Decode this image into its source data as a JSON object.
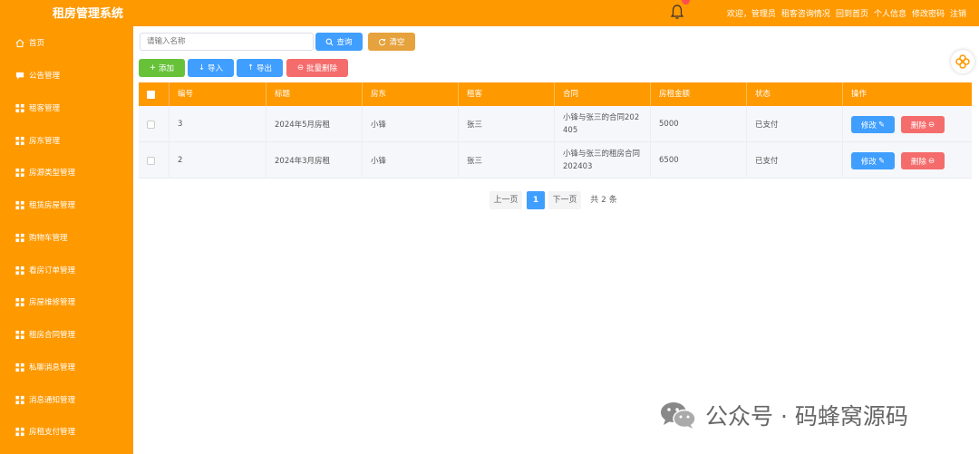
{
  "app": {
    "title": "租房管理系统"
  },
  "topbar": {
    "links": [
      "欢迎，管理员",
      "租客咨询情况",
      "回到首页",
      "个人信息",
      "修改密码",
      "注销"
    ]
  },
  "sidebar": {
    "items": [
      {
        "label": "首页",
        "icon": "home-icon"
      },
      {
        "label": "公告管理",
        "icon": "notice-icon"
      },
      {
        "label": "租客管理",
        "icon": "grid-icon"
      },
      {
        "label": "房东管理",
        "icon": "grid-icon"
      },
      {
        "label": "房源类型管理",
        "icon": "grid-icon"
      },
      {
        "label": "租赁房屋管理",
        "icon": "grid-icon"
      },
      {
        "label": "购物车管理",
        "icon": "grid-icon"
      },
      {
        "label": "看房订单管理",
        "icon": "grid-icon"
      },
      {
        "label": "房屋维修管理",
        "icon": "grid-icon"
      },
      {
        "label": "租房合同管理",
        "icon": "grid-icon"
      },
      {
        "label": "私聊消息管理",
        "icon": "grid-icon"
      },
      {
        "label": "消息通知管理",
        "icon": "grid-icon"
      },
      {
        "label": "房租支付管理",
        "icon": "grid-icon"
      }
    ]
  },
  "toolbar": {
    "search_placeholder": "请输入名称",
    "search_label": "查询",
    "clear_label": "清空",
    "add_label": "添加",
    "import_label": "导入",
    "export_label": "导出",
    "batch_delete_label": "批量删除"
  },
  "table": {
    "headers": [
      "编号",
      "标题",
      "房东",
      "租客",
      "合同",
      "房租金额",
      "状态",
      "操作"
    ],
    "rows": [
      {
        "id": "3",
        "title": "2024年5月房租",
        "landlord": "小锋",
        "tenant": "张三",
        "contract": "小锋与张三的合同202405",
        "amount": "5000",
        "status": "已支付"
      },
      {
        "id": "2",
        "title": "2024年3月房租",
        "landlord": "小锋",
        "tenant": "张三",
        "contract": "小锋与张三的租房合同202403",
        "amount": "6500",
        "status": "已支付"
      }
    ],
    "edit_label": "修改",
    "delete_label": "删除"
  },
  "pagination": {
    "prev_label": "上一页",
    "current_page": "1",
    "next_label": "下一页",
    "total_label": "共 2 条"
  },
  "watermark": {
    "text": "公众号 · 码蜂窝源码"
  },
  "colors": {
    "primary": "#ff9900",
    "blue": "#409eff",
    "green": "#67c23a",
    "red": "#f56c6c",
    "amber": "#e6a23c"
  }
}
